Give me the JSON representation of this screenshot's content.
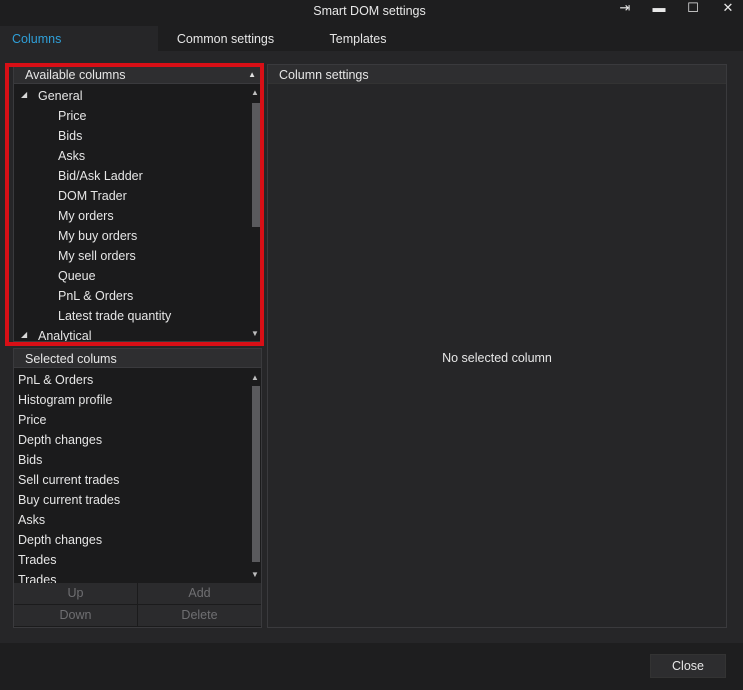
{
  "window": {
    "title": "Smart DOM settings",
    "pin_icon": "⇥",
    "minimize_icon": "▬",
    "maximize_icon": "☐",
    "close_icon": "✕"
  },
  "tabs": [
    {
      "label": "Columns",
      "active": true
    },
    {
      "label": "Common settings",
      "active": false
    },
    {
      "label": "Templates",
      "active": false
    }
  ],
  "available_columns": {
    "header": "Available columns",
    "groups": [
      {
        "label": "General",
        "expanded": true,
        "items": [
          "Price",
          "Bids",
          "Asks",
          "Bid/Ask Ladder",
          "DOM Trader",
          "My orders",
          "My buy orders",
          "My sell orders",
          "Queue",
          "PnL & Orders",
          "Latest trade quantity"
        ]
      },
      {
        "label": "Analytical",
        "expanded": true,
        "items": []
      }
    ]
  },
  "selected_columns": {
    "header": "Selected colums",
    "items": [
      "PnL & Orders",
      "Histogram profile",
      "Price",
      "Depth changes",
      "Bids",
      "Sell current trades",
      "Buy current trades",
      "Asks",
      "Depth changes",
      "Trades",
      "Trades"
    ],
    "buttons": {
      "up": "Up",
      "add": "Add",
      "down": "Down",
      "delete": "Delete"
    }
  },
  "column_settings": {
    "header": "Column settings",
    "empty_message": "No selected column"
  },
  "footer": {
    "close_label": "Close"
  },
  "colors": {
    "accent": "#2f9fd8",
    "highlight": "#d80f16"
  }
}
